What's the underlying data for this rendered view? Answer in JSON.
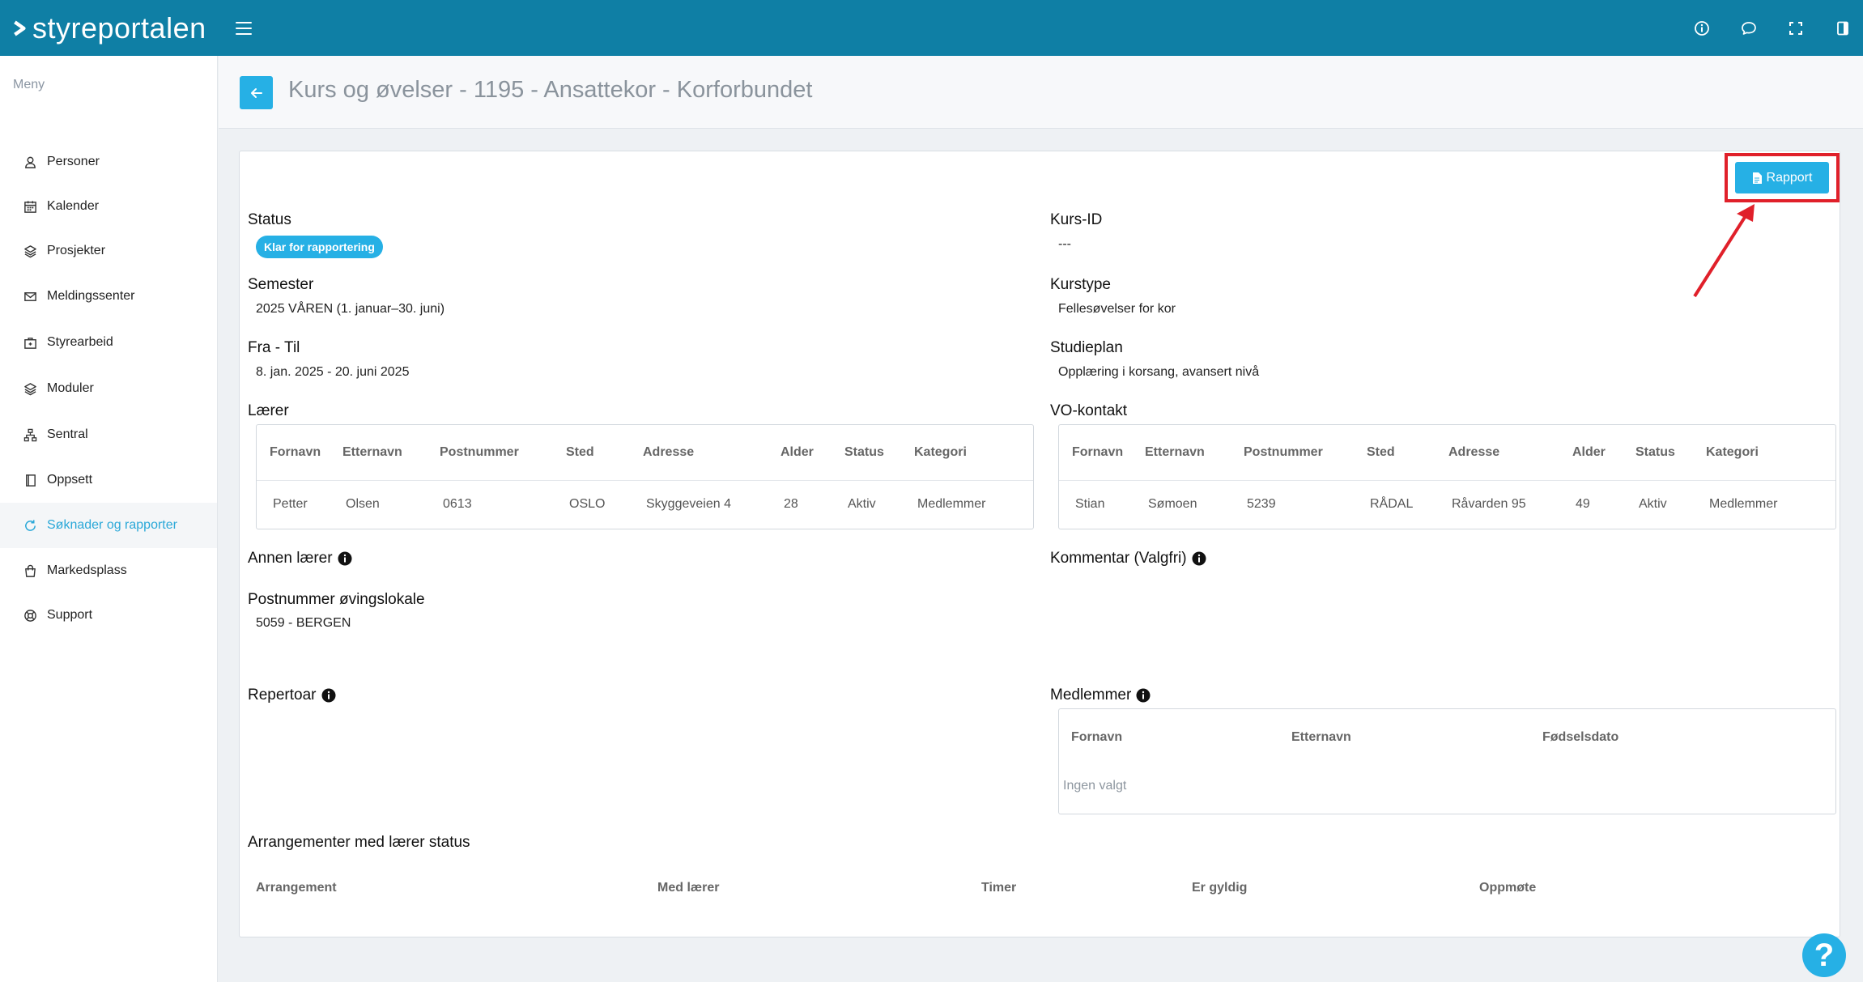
{
  "app": {
    "logo_text": "styreportalen"
  },
  "topbar": {
    "icons": [
      "info-icon",
      "chat-icon",
      "fullscreen-icon",
      "panel-icon"
    ]
  },
  "sidebar": {
    "title": "Meny",
    "items": [
      {
        "label": "Personer",
        "icon": "person-icon"
      },
      {
        "label": "Kalender",
        "icon": "calendar-icon"
      },
      {
        "label": "Prosjekter",
        "icon": "layers-icon"
      },
      {
        "label": "Meldingssenter",
        "icon": "mail-icon"
      },
      {
        "label": "Styrearbeid",
        "icon": "briefcase-icon"
      },
      {
        "label": "Moduler",
        "icon": "layers-icon"
      },
      {
        "label": "Sentral",
        "icon": "sitemap-icon"
      },
      {
        "label": "Oppsett",
        "icon": "book-icon"
      },
      {
        "label": "Søknader og rapporter",
        "icon": "refresh-icon",
        "active": true
      },
      {
        "label": "Markedsplass",
        "icon": "bag-icon"
      },
      {
        "label": "Support",
        "icon": "lifebuoy-icon"
      }
    ]
  },
  "header": {
    "title": "Kurs og øvelser - 1195 - Ansattekor - Korforbundet"
  },
  "actions": {
    "rapport_label": "Rapport"
  },
  "fields": {
    "status_label": "Status",
    "status_value": "Klar for rapportering",
    "kursid_label": "Kurs-ID",
    "kursid_value": "---",
    "semester_label": "Semester",
    "semester_value": "2025 VÅREN (1. januar–30. juni)",
    "kurstype_label": "Kurstype",
    "kurstype_value": "Fellesøvelser for kor",
    "fratil_label": "Fra - Til",
    "fratil_value": "8. jan. 2025 - 20. juni 2025",
    "studieplan_label": "Studieplan",
    "studieplan_value": "Opplæring i korsang, avansert nivå",
    "laerer_label": "Lærer",
    "vokontakt_label": "VO-kontakt",
    "annen_laerer_label": "Annen lærer",
    "kommentar_label": "Kommentar (Valgfri)",
    "postnummer_label": "Postnummer øvingslokale",
    "postnummer_value": "5059 - BERGEN",
    "repertoar_label": "Repertoar",
    "medlemmer_label": "Medlemmer",
    "arrangementer_label": "Arrangementer med lærer status"
  },
  "person_table": {
    "headers": [
      "Fornavn",
      "Etternavn",
      "Postnummer",
      "Sted",
      "Adresse",
      "Alder",
      "Status",
      "Kategori"
    ]
  },
  "laerer_row": [
    "Petter",
    "Olsen",
    "0613",
    "OSLO",
    "Skyggeveien 4",
    "28",
    "Aktiv",
    "Medlemmer"
  ],
  "vokontakt_row": [
    "Stian",
    "Sømoen",
    "5239",
    "RÅDAL",
    "Råvarden 95",
    "49",
    "Aktiv",
    "Medlemmer"
  ],
  "medlemmer_table": {
    "headers": [
      "Fornavn",
      "Etternavn",
      "Fødselsdato"
    ],
    "empty_text": "Ingen valgt"
  },
  "arrangementer_table": {
    "headers": [
      "Arrangement",
      "Med lærer",
      "Timer",
      "Er gyldig",
      "Oppmøte"
    ]
  },
  "colors": {
    "topbar": "#0f7fa5",
    "accent": "#26b0e5",
    "highlight": "#e0202a"
  }
}
